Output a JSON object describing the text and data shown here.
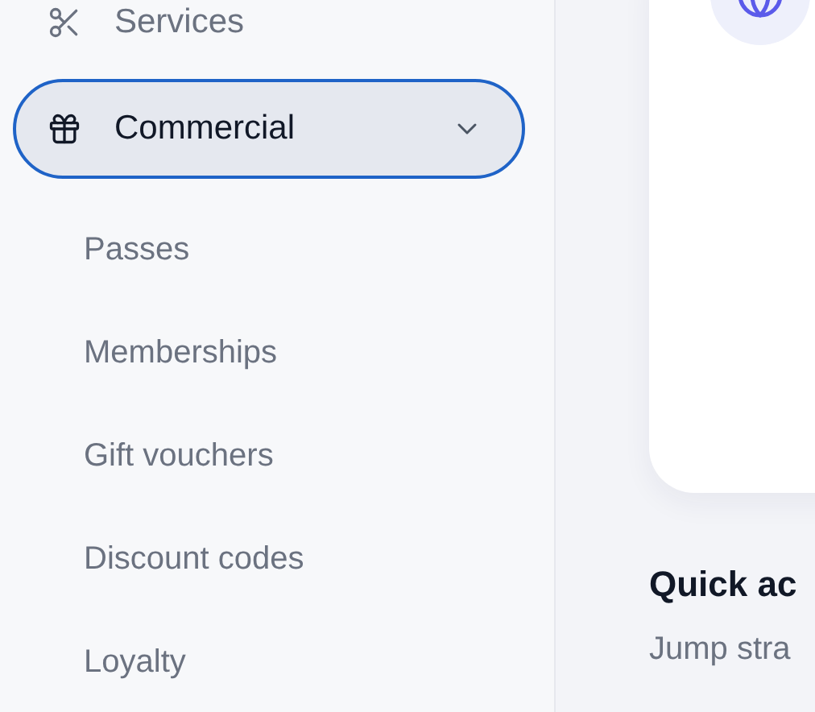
{
  "sidebar": {
    "items": [
      {
        "label": "Services",
        "selected": false
      },
      {
        "label": "Commercial",
        "selected": true,
        "expanded": true,
        "children": [
          {
            "label": "Passes",
            "selected": false
          },
          {
            "label": "Memberships",
            "selected": false
          },
          {
            "label": "Gift vouchers",
            "selected": false
          },
          {
            "label": "Discount codes",
            "selected": false
          },
          {
            "label": "Loyalty",
            "selected": false
          }
        ]
      }
    ]
  },
  "main": {
    "section": {
      "title": "Quick ac",
      "subtitle": "Jump stra"
    }
  }
}
